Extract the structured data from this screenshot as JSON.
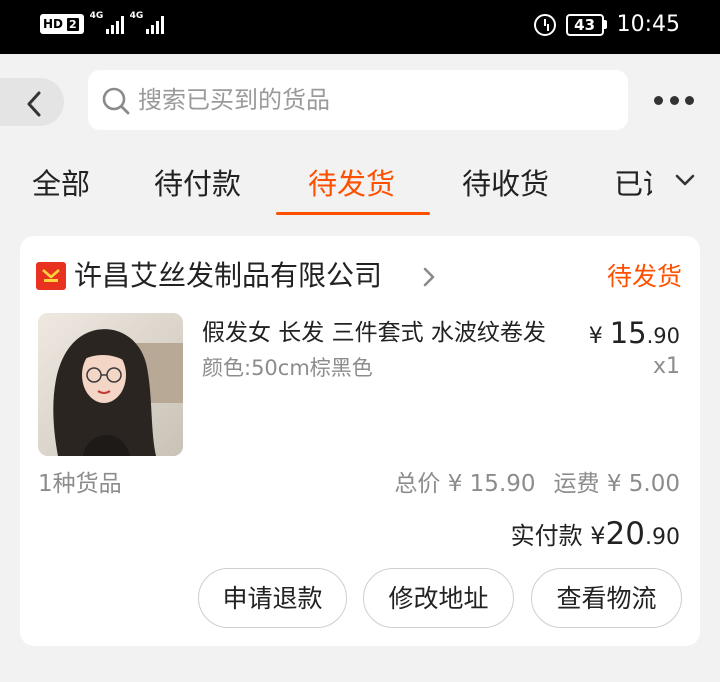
{
  "status_bar": {
    "hd_label": "HD",
    "sim_label": "2",
    "net1_label": "4G",
    "net2_label": "4G",
    "battery": "43",
    "time": "10:45"
  },
  "header": {
    "search_placeholder": "搜索已买到的货品"
  },
  "tabs": [
    {
      "label": "全部"
    },
    {
      "label": "待付款"
    },
    {
      "label": "待发货"
    },
    {
      "label": "待收货"
    },
    {
      "label": "已评价"
    }
  ],
  "active_tab": "待发货",
  "order": {
    "shop_name": "许昌艾丝发制品有限公司",
    "status": "待发货",
    "product": {
      "title": "假发女 长发 三件套式 水波纹卷发",
      "spec": "颜色:50cm棕黑色",
      "price_symbol": "¥",
      "price_int": "15",
      "price_dec": ".90",
      "quantity": "x1"
    },
    "item_count": "1种货品",
    "total": "总价 ¥ 15.90",
    "shipping": "运费 ¥ 5.00",
    "paid_label": "实付款",
    "paid_symbol": "¥",
    "paid_int": "20",
    "paid_dec": ".90"
  },
  "buttons": {
    "refund": "申请退款",
    "change_address": "修改地址",
    "logistics": "查看物流"
  },
  "colors": {
    "accent": "#ff5000",
    "shop_icon": "#e8321f"
  }
}
